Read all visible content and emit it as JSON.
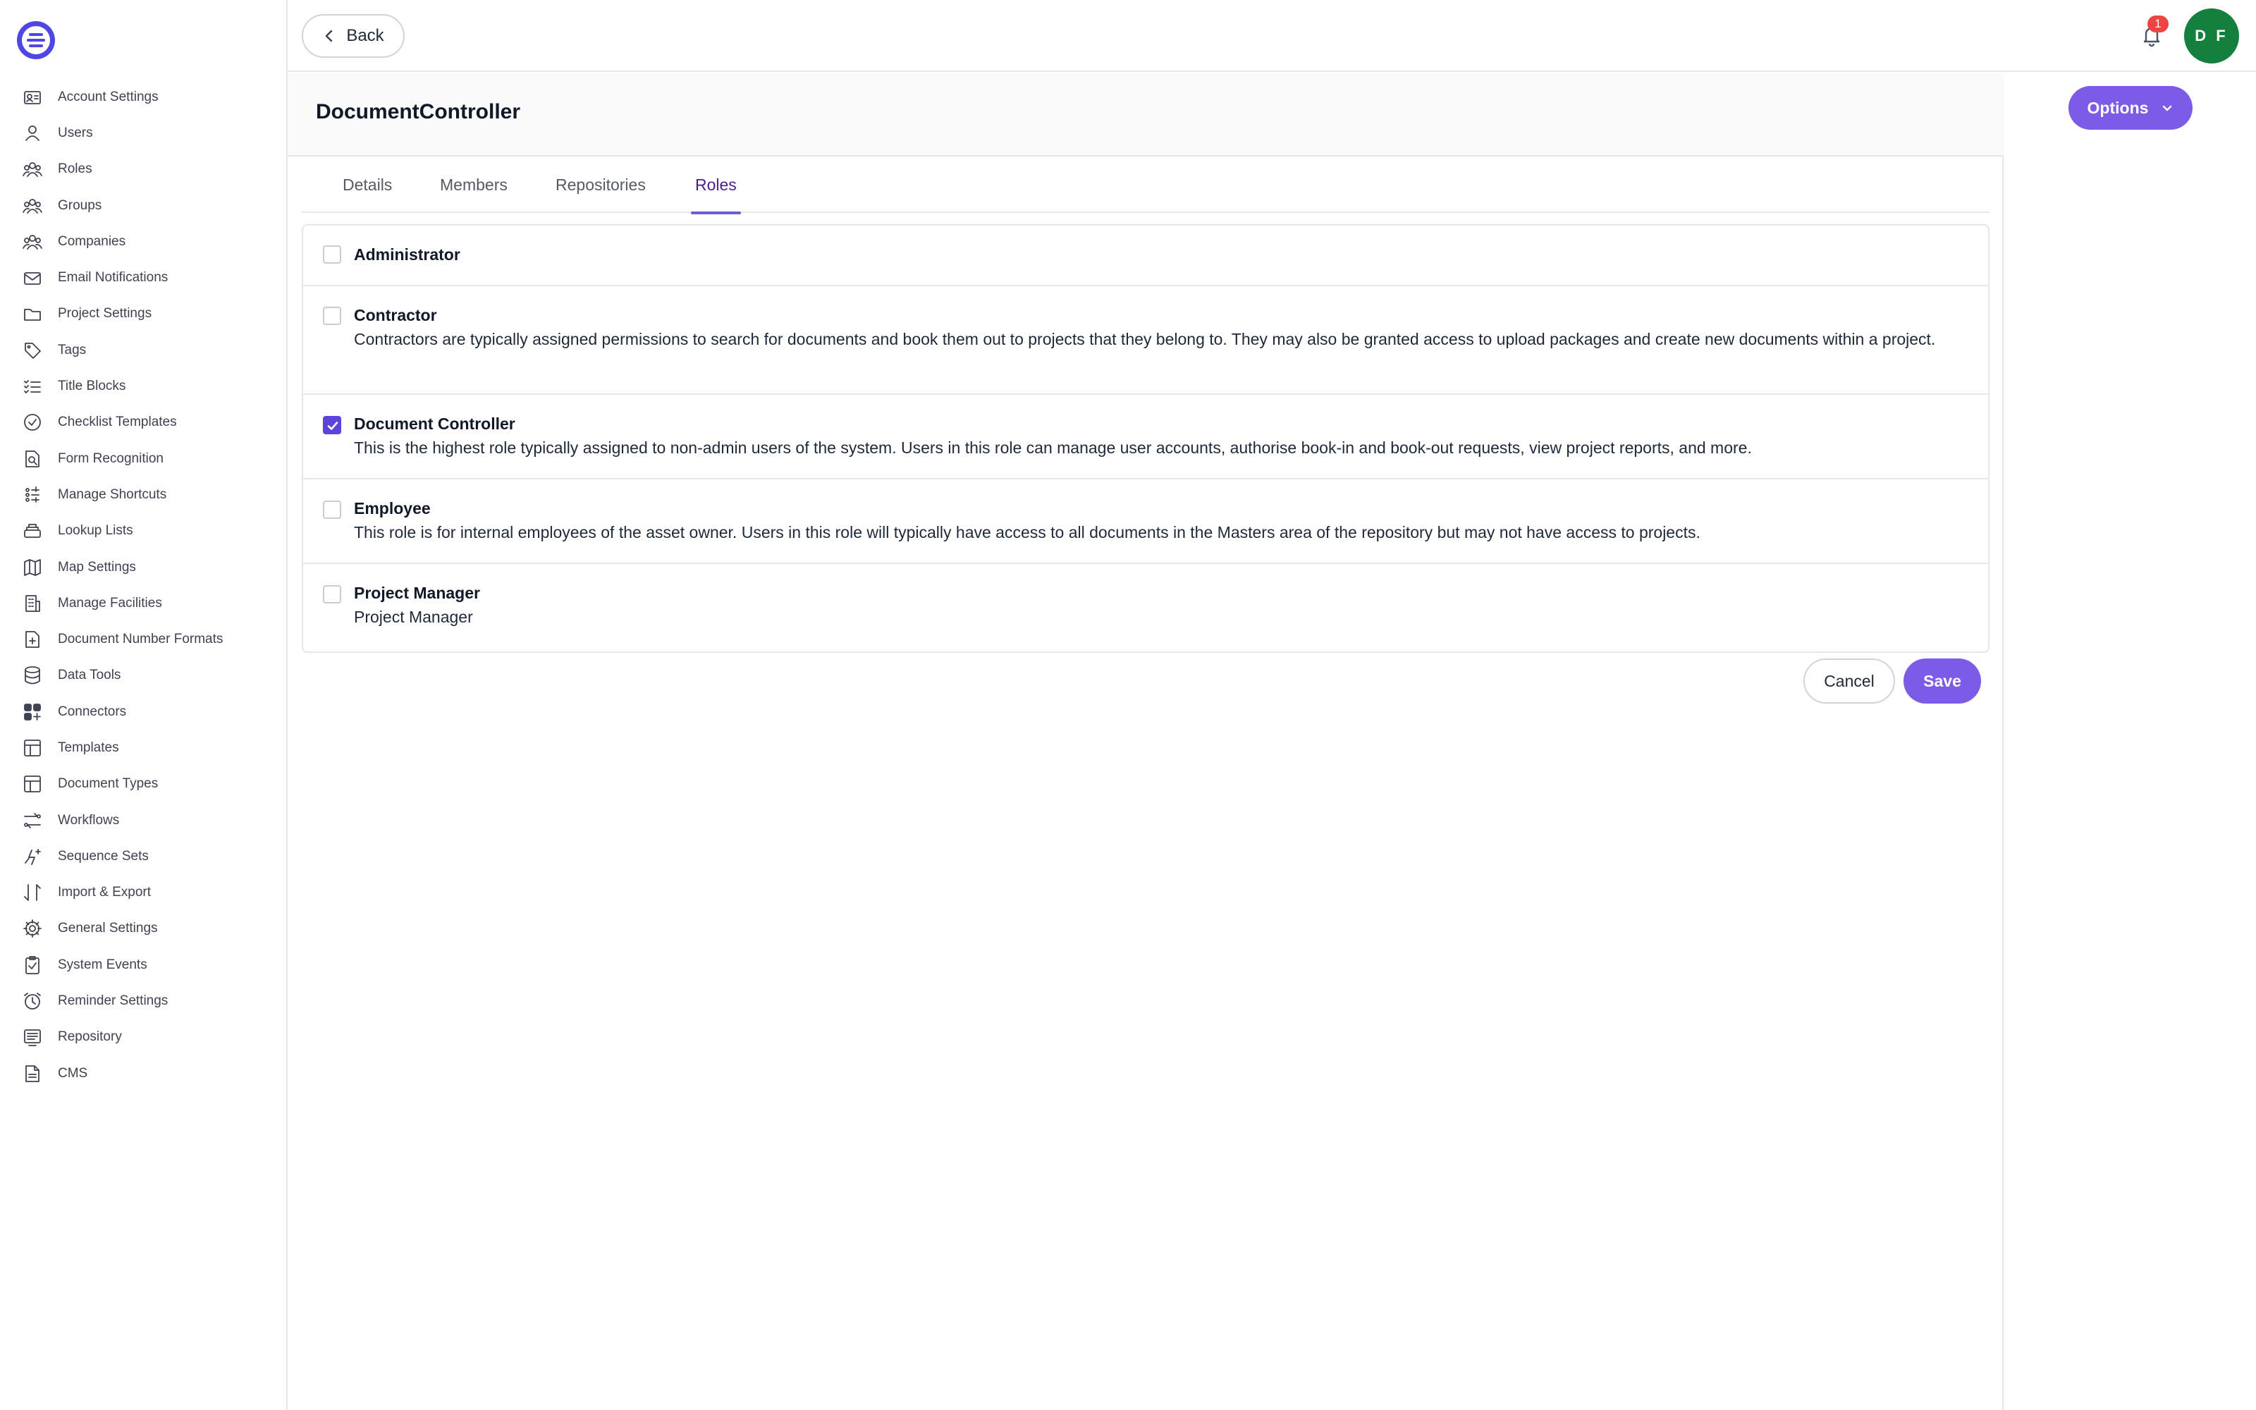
{
  "sidebar": {
    "logo_icon": "logo-icon",
    "items": [
      {
        "label": "Account Settings",
        "icon": "account-settings-icon"
      },
      {
        "label": "Users",
        "icon": "user-icon"
      },
      {
        "label": "Roles",
        "icon": "roles-icon"
      },
      {
        "label": "Groups",
        "icon": "groups-icon"
      },
      {
        "label": "Companies",
        "icon": "companies-icon"
      },
      {
        "label": "Email Notifications",
        "icon": "envelope-icon"
      },
      {
        "label": "Project Settings",
        "icon": "folder-icon"
      },
      {
        "label": "Tags",
        "icon": "tag-icon"
      },
      {
        "label": "Title Blocks",
        "icon": "checklist-icon"
      },
      {
        "label": "Checklist Templates",
        "icon": "check-circle-icon"
      },
      {
        "label": "Form Recognition",
        "icon": "document-search-icon"
      },
      {
        "label": "Manage Shortcuts",
        "icon": "shortcut-icon"
      },
      {
        "label": "Lookup Lists",
        "icon": "stack-icon"
      },
      {
        "label": "Map Settings",
        "icon": "map-icon"
      },
      {
        "label": "Manage Facilities",
        "icon": "building-icon"
      },
      {
        "label": "Document Number Formats",
        "icon": "document-number-icon"
      },
      {
        "label": "Data Tools",
        "icon": "database-icon"
      },
      {
        "label": "Connectors",
        "icon": "connectors-icon"
      },
      {
        "label": "Templates",
        "icon": "template-icon"
      },
      {
        "label": "Document Types",
        "icon": "document-types-icon"
      },
      {
        "label": "Workflows",
        "icon": "workflow-icon"
      },
      {
        "label": "Sequence Sets",
        "icon": "sequence-icon"
      },
      {
        "label": "Import & Export",
        "icon": "import-export-icon"
      },
      {
        "label": "General Settings",
        "icon": "gear-icon"
      },
      {
        "label": "System Events",
        "icon": "clipboard-check-icon"
      },
      {
        "label": "Reminder Settings",
        "icon": "alarm-clock-icon"
      },
      {
        "label": "Repository",
        "icon": "repository-icon"
      },
      {
        "label": "CMS",
        "icon": "file-icon"
      }
    ]
  },
  "topbar": {
    "back_label": "Back",
    "notification_count": "1",
    "avatar_initials": "D F"
  },
  "page": {
    "title": "DocumentController"
  },
  "tabs": [
    {
      "label": "Details",
      "active": false
    },
    {
      "label": "Members",
      "active": false
    },
    {
      "label": "Repositories",
      "active": false
    },
    {
      "label": "Roles",
      "active": true
    }
  ],
  "roles": [
    {
      "name": "Administrator",
      "description": "",
      "checked": false
    },
    {
      "name": "Contractor",
      "description": "Contractors are typically assigned permissions to search for documents and book them out to projects that they belong to. They may also be granted access to upload packages and create new documents within a project.",
      "checked": false
    },
    {
      "name": "Document Controller",
      "description": "This is the highest role typically assigned to non-admin users of the system. Users in this role can manage user accounts, authorise book-in and book-out requests, view project reports, and more.",
      "checked": true
    },
    {
      "name": "Employee",
      "description": "This role is for internal employees of the asset owner. Users in this role will typically have access to all documents in the Masters area of the repository but may not have access to projects.",
      "checked": false
    },
    {
      "name": "Project Manager",
      "description": "Project Manager",
      "checked": false
    }
  ],
  "actions": {
    "cancel_label": "Cancel",
    "save_label": "Save",
    "options_label": "Options"
  },
  "colors": {
    "accent": "#7c5ce6",
    "checkbox_checked": "#5b44d9",
    "avatar": "#15803d",
    "badge": "#ef4444"
  }
}
